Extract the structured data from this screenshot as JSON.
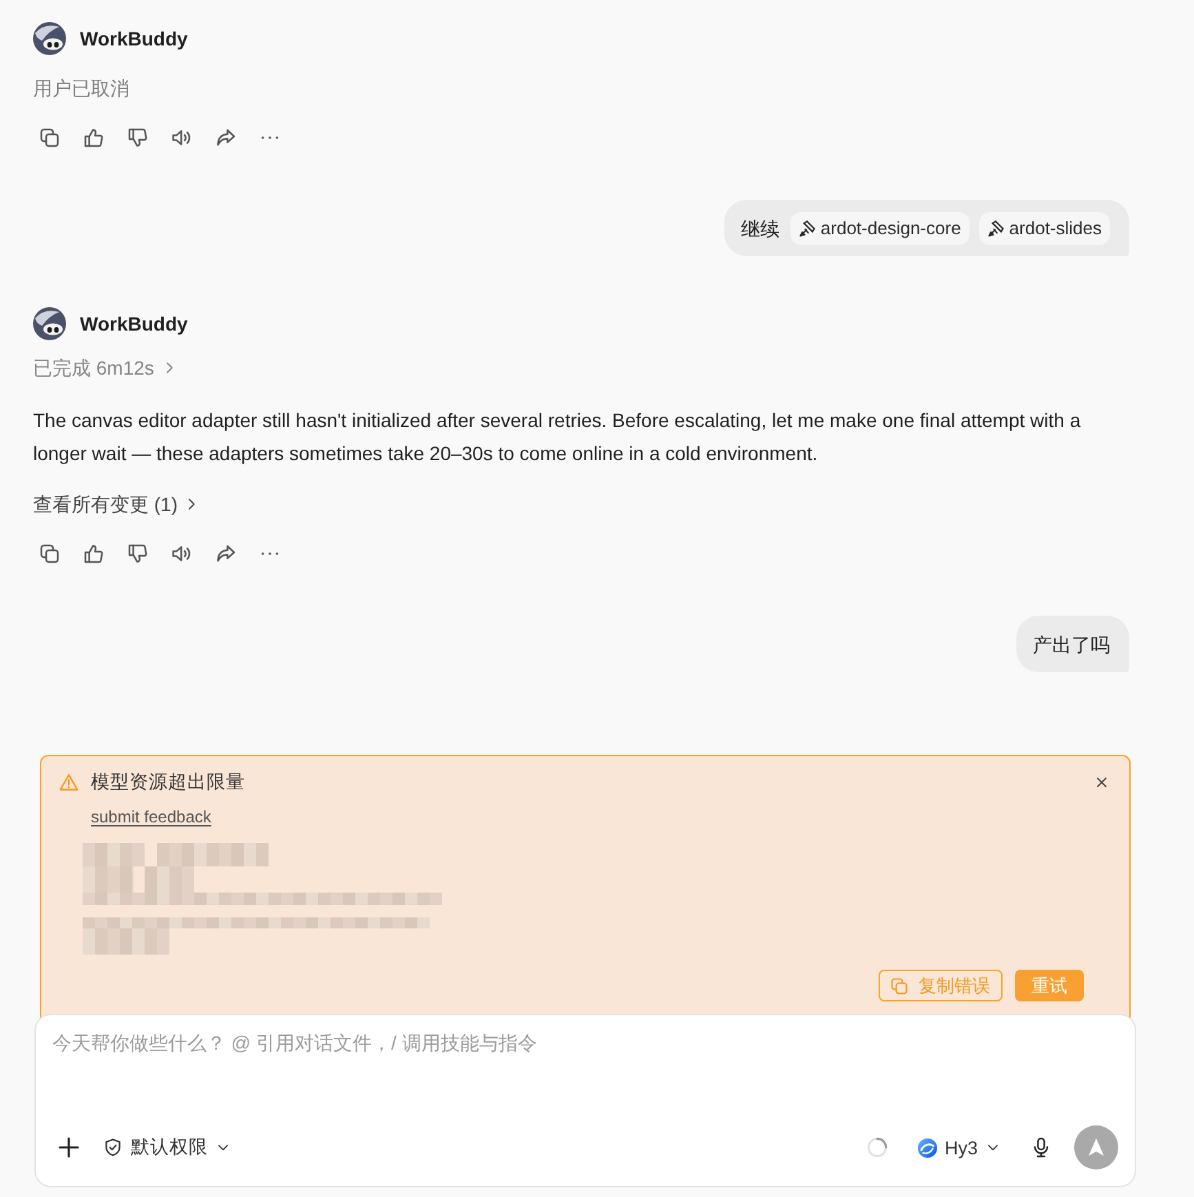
{
  "messages": [
    {
      "kind": "assistant",
      "author": "WorkBuddy",
      "notice": "用户已取消"
    },
    {
      "kind": "user",
      "text": "继续",
      "chips": [
        "ardot-design-core",
        "ardot-slides"
      ]
    },
    {
      "kind": "assistant",
      "author": "WorkBuddy",
      "status": {
        "label": "已完成 6m12s",
        "expanded": false
      },
      "text": "The canvas editor adapter still hasn't initialized after several retries. Before escalating, let me make one final attempt with a longer wait — these adapters sometimes take 20–30s to come online in a cold environment.",
      "changes_link": "查看所有变更 (1)"
    },
    {
      "kind": "user",
      "text": "产出了吗"
    }
  ],
  "error_banner": {
    "title": "模型资源超出限量",
    "link": "submit feedback",
    "buttons": [
      {
        "kind": "outline",
        "label": "复制错误"
      },
      {
        "kind": "primary",
        "label": "重试"
      }
    ]
  },
  "composer": {
    "placeholder": "今天帮你做些什么？ @ 引用对话文件，/ 调用技能与指令",
    "permission": "默认权限",
    "model": "Hy3",
    "send_button": {
      "disabled": true
    }
  }
}
